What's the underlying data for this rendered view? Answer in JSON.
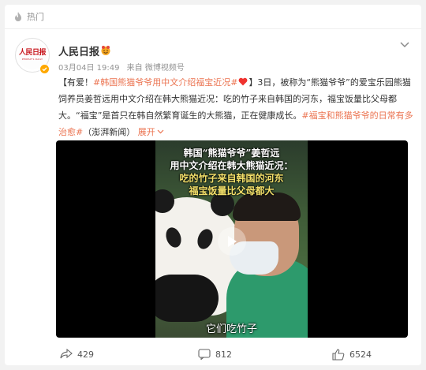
{
  "hot": {
    "label": "热门",
    "icon": "flame-icon"
  },
  "post": {
    "author": {
      "name": "人民日报",
      "avatar_text": "人民日报",
      "avatar_subtext": "PEOPLE'S DAILY",
      "badge_icon": "smiley-badge-icon",
      "verified_icon": "verified-check-icon"
    },
    "time": "03月04日 19:49",
    "source": "来自 微博视频号",
    "body": {
      "prefix": "【有爱！",
      "tag1": "#韩国熊猫爷爷用中文介绍福宝近况#",
      "heart_icon": "heart-icon",
      "main": "】3日，被称为“熊猫爷爷”的爱宝乐园熊猫饲养员姜哲远用中文介绍在韩大熊猫近况：吃的竹子来自韩国的河东，福宝饭量比父母都大。“福宝”是首只在韩自然繁育诞生的大熊猫，正在健康成长。",
      "tag2": "#福宝和熊猫爷爷的日常有多治愈#",
      "suffix": "（澎湃新闻）",
      "expand": "展开",
      "expand_icon": "chevron-down-icon"
    },
    "video": {
      "caption_line1": "韩国“熊猫爷爷”姜哲远",
      "caption_line2": "用中文介绍在韩大熊猫近况：",
      "caption_line3": "吃的竹子来自韩国的河东",
      "caption_line4": "福宝饭量比父母都大",
      "subtitle": "它们吃竹子",
      "play_icon": "play-icon"
    },
    "actions": {
      "share_count": "429",
      "comment_count": "812",
      "like_count": "6524"
    }
  },
  "colors": {
    "accent": "#eb7350",
    "verified": "#ffa800",
    "background": "#f2f2f2"
  }
}
